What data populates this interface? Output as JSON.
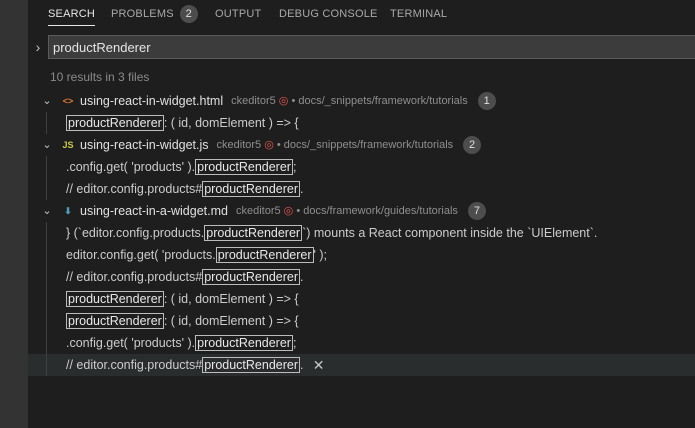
{
  "tabs": [
    {
      "label": "SEARCH",
      "active": true
    },
    {
      "label": "PROBLEMS",
      "badge": "2"
    },
    {
      "label": "OUTPUT"
    },
    {
      "label": "DEBUG CONSOLE"
    },
    {
      "label": "TERMINAL"
    }
  ],
  "search": {
    "value": "productRenderer",
    "toggle_icon": "chevron-right-icon"
  },
  "summary": "10 results in 3 files",
  "files": [
    {
      "name": "using-react-in-widget.html",
      "icon": "html-file-icon",
      "icon_glyph": "<>",
      "icon_color": "#e37933",
      "workspace": "ckeditor5",
      "path": "docs/_snippets/framework/tutorials",
      "count": "1",
      "matches": [
        {
          "pre": "",
          "hl": "productRenderer",
          "post": ": ( id, domElement ) => {"
        }
      ]
    },
    {
      "name": "using-react-in-widget.js",
      "icon": "js-file-icon",
      "icon_glyph": "JS",
      "icon_color": "#cbcb41",
      "workspace": "ckeditor5",
      "path": "docs/_snippets/framework/tutorials",
      "count": "2",
      "matches": [
        {
          "pre": ".config.get( 'products' ).",
          "hl": "productRenderer",
          "post": ";"
        },
        {
          "pre": "// editor.config.products#",
          "hl": "productRenderer",
          "post": "."
        }
      ]
    },
    {
      "name": "using-react-in-a-widget.md",
      "icon": "markdown-file-icon",
      "icon_glyph": "⬇",
      "icon_color": "#519aba",
      "workspace": "ckeditor5",
      "path": "docs/framework/guides/tutorials",
      "count": "7",
      "matches": [
        {
          "pre": "} (`editor.config.products.",
          "hl": "productRenderer",
          "post": "`) mounts a React component inside the `UIElement`."
        },
        {
          "pre": "editor.config.get( 'products.",
          "hl": "productRenderer",
          "post": "' );"
        },
        {
          "pre": "// editor.config.products#",
          "hl": "productRenderer",
          "post": "."
        },
        {
          "pre": "",
          "hl": "productRenderer",
          "post": ": ( id, domElement ) => {"
        },
        {
          "pre": "",
          "hl": "productRenderer",
          "post": ": ( id, domElement ) => {"
        },
        {
          "pre": ".config.get( 'products' ).",
          "hl": "productRenderer",
          "post": ";"
        },
        {
          "pre": "// editor.config.products#",
          "hl": "productRenderer",
          "post": ".",
          "selected": true,
          "dismiss_glyph": "✕"
        }
      ]
    }
  ],
  "icons": {
    "collapse": "chevron-down-icon",
    "collapse_glyph": "⌄",
    "workspace": "target-icon",
    "workspace_glyph": "◎",
    "dismiss": "close-icon"
  }
}
